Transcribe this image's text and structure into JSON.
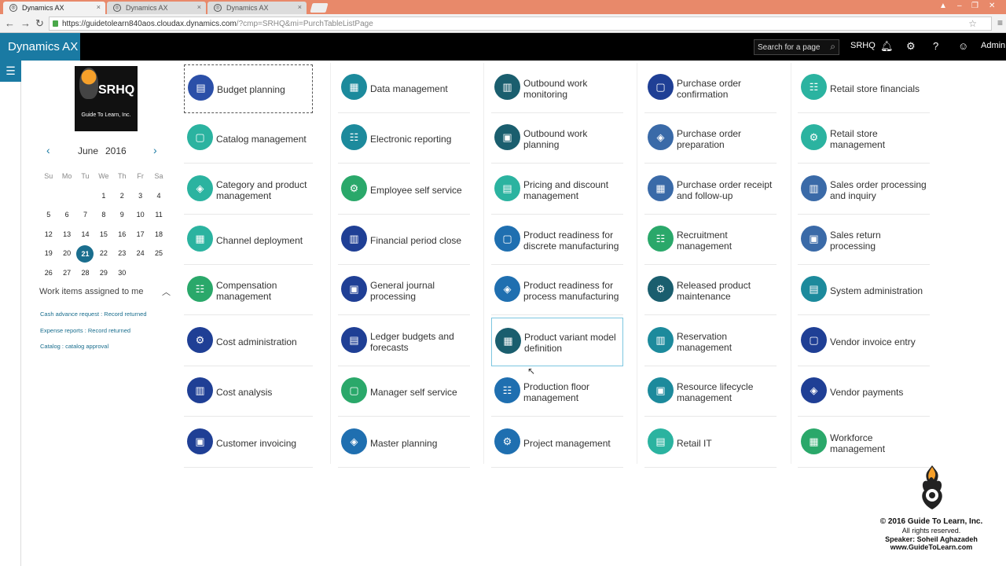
{
  "browser": {
    "tabs": [
      {
        "label": "Dynamics AX",
        "active": true
      },
      {
        "label": "Dynamics AX",
        "active": false
      },
      {
        "label": "Dynamics AX",
        "active": false
      }
    ],
    "url_host": "https://guidetolearn840aos.cloudax.dynamics.com",
    "url_rest": "/?cmp=SRHQ&mi=PurchTableListPage"
  },
  "header": {
    "brand": "Dynamics AX",
    "search_placeholder": "Search for a page",
    "company": "SRHQ",
    "user": "Admin"
  },
  "logo": {
    "title": "SRHQ",
    "subtitle": "Guide To Learn, Inc."
  },
  "calendar": {
    "month": "June",
    "year": "2016",
    "weekdays": [
      "Su",
      "Mo",
      "Tu",
      "We",
      "Th",
      "Fr",
      "Sa"
    ],
    "weeks": [
      [
        "",
        "",
        "",
        "1",
        "2",
        "3",
        "4"
      ],
      [
        "5",
        "6",
        "7",
        "8",
        "9",
        "10",
        "11"
      ],
      [
        "12",
        "13",
        "14",
        "15",
        "16",
        "17",
        "18"
      ],
      [
        "19",
        "20",
        "21",
        "22",
        "23",
        "24",
        "25"
      ],
      [
        "26",
        "27",
        "28",
        "29",
        "30",
        "",
        ""
      ]
    ],
    "today": "21"
  },
  "work_items": {
    "title": "Work items assigned to me",
    "items": [
      "Cash advance request : Record returned",
      "Expense reports : Record returned",
      "Catalog : catalog approval"
    ]
  },
  "tiles": [
    [
      {
        "label": "Budget planning",
        "color": "#2b4fa8",
        "icon": "budget-icon"
      },
      {
        "label": "Catalog management",
        "color": "#2bb3a0",
        "icon": "catalog-icon"
      },
      {
        "label": "Category and product management",
        "color": "#2bb3a0",
        "icon": "category-icon"
      },
      {
        "label": "Channel deployment",
        "color": "#2bb3a0",
        "icon": "channel-icon"
      },
      {
        "label": "Compensation management",
        "color": "#2aa86a",
        "icon": "compensation-icon"
      },
      {
        "label": "Cost administration",
        "color": "#1f3f95",
        "icon": "cost-admin-icon"
      },
      {
        "label": "Cost analysis",
        "color": "#1f3f95",
        "icon": "cost-analysis-icon"
      },
      {
        "label": "Customer invoicing",
        "color": "#1f3f95",
        "icon": "invoice-icon"
      }
    ],
    [
      {
        "label": "Data management",
        "color": "#1c8a9c",
        "icon": "data-icon"
      },
      {
        "label": "Electronic reporting",
        "color": "#1c8a9c",
        "icon": "reporting-icon"
      },
      {
        "label": "Employee self service",
        "color": "#2aa86a",
        "icon": "employee-icon"
      },
      {
        "label": "Financial period close",
        "color": "#1f3f95",
        "icon": "period-close-icon"
      },
      {
        "label": "General journal processing",
        "color": "#1f3f95",
        "icon": "journal-icon"
      },
      {
        "label": "Ledger budgets and forecasts",
        "color": "#1f3f95",
        "icon": "ledger-icon"
      },
      {
        "label": "Manager self service",
        "color": "#2aa86a",
        "icon": "manager-icon"
      },
      {
        "label": "Master planning",
        "color": "#1f6fb0",
        "icon": "planning-icon"
      }
    ],
    [
      {
        "label": "Outbound work monitoring",
        "color": "#1a5e6e",
        "icon": "outbound-monitor-icon"
      },
      {
        "label": "Outbound work planning",
        "color": "#1a5e6e",
        "icon": "outbound-plan-icon"
      },
      {
        "label": "Pricing and discount management",
        "color": "#2bb3a0",
        "icon": "pricing-icon"
      },
      {
        "label": "Product readiness for discrete manufacturing",
        "color": "#1f6fb0",
        "icon": "discrete-icon"
      },
      {
        "label": "Product readiness for process manufacturing",
        "color": "#1f6fb0",
        "icon": "process-icon"
      },
      {
        "label": "Product variant model definition",
        "color": "#1a5e6e",
        "icon": "variant-icon"
      },
      {
        "label": "Production floor management",
        "color": "#1f6fb0",
        "icon": "production-icon"
      },
      {
        "label": "Project management",
        "color": "#1f6fb0",
        "icon": "project-icon"
      }
    ],
    [
      {
        "label": "Purchase order confirmation",
        "color": "#1f3f95",
        "icon": "po-confirm-icon"
      },
      {
        "label": "Purchase order preparation",
        "color": "#3a6aa8",
        "icon": "po-prep-icon"
      },
      {
        "label": "Purchase order receipt and follow-up",
        "color": "#3a6aa8",
        "icon": "po-receipt-icon"
      },
      {
        "label": "Recruitment management",
        "color": "#2aa86a",
        "icon": "recruit-icon"
      },
      {
        "label": "Released product maintenance",
        "color": "#1a5e6e",
        "icon": "released-icon"
      },
      {
        "label": "Reservation management",
        "color": "#1c8a9c",
        "icon": "reservation-icon"
      },
      {
        "label": "Resource lifecycle management",
        "color": "#1c8a9c",
        "icon": "resource-icon"
      },
      {
        "label": "Retail IT",
        "color": "#2bb3a0",
        "icon": "retail-it-icon"
      }
    ],
    [
      {
        "label": "Retail store financials",
        "color": "#2bb3a0",
        "icon": "store-fin-icon"
      },
      {
        "label": "Retail store management",
        "color": "#2bb3a0",
        "icon": "store-mgmt-icon"
      },
      {
        "label": "Sales order processing and inquiry",
        "color": "#3a6aa8",
        "icon": "sales-order-icon"
      },
      {
        "label": "Sales return processing",
        "color": "#3a6aa8",
        "icon": "sales-return-icon"
      },
      {
        "label": "System administration",
        "color": "#1c8a9c",
        "icon": "sysadmin-icon"
      },
      {
        "label": "Vendor invoice entry",
        "color": "#1f3f95",
        "icon": "vendor-invoice-icon"
      },
      {
        "label": "Vendor payments",
        "color": "#1f3f95",
        "icon": "vendor-pay-icon"
      },
      {
        "label": "Workforce management",
        "color": "#2aa86a",
        "icon": "workforce-icon"
      }
    ]
  ],
  "watermark": {
    "copyright": "© 2016 Guide To Learn, Inc.",
    "rights": "All rights reserved.",
    "speaker": "Speaker: Soheil Aghazadeh",
    "site": "www.GuideToLearn.com"
  }
}
